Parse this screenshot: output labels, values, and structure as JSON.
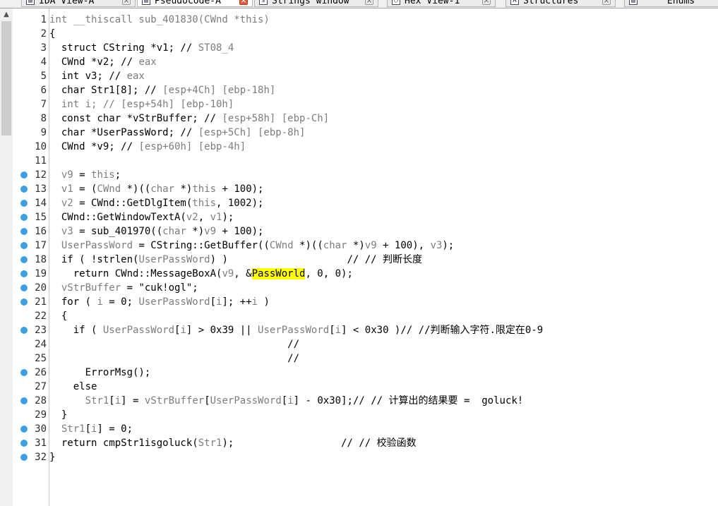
{
  "tabs": [
    {
      "label": "IDA View-A",
      "icon": "ida-view-icon"
    },
    {
      "label": "Pseudocode-A",
      "icon": "pseudocode-icon",
      "active": true
    },
    {
      "label": "Strings window",
      "icon": "strings-icon"
    },
    {
      "label": "Hex View-1",
      "icon": "hex-view-icon"
    },
    {
      "label": "Structures",
      "icon": "structures-icon"
    },
    {
      "label": "Enums",
      "icon": "enums-icon"
    }
  ],
  "code": {
    "lines": [
      {
        "n": "1",
        "dot": false,
        "segs": [
          [
            "c-gray",
            "int __thiscall sub_401830(CWnd *this)"
          ]
        ]
      },
      {
        "n": "2",
        "dot": false,
        "segs": [
          [
            "",
            "{"
          ]
        ]
      },
      {
        "n": "3",
        "dot": false,
        "segs": [
          [
            "",
            "  struct CString *v1; // "
          ],
          [
            "c-gray",
            "ST08_4"
          ]
        ]
      },
      {
        "n": "4",
        "dot": false,
        "segs": [
          [
            "",
            "  CWnd *v2; // "
          ],
          [
            "c-gray",
            "eax"
          ]
        ]
      },
      {
        "n": "5",
        "dot": false,
        "segs": [
          [
            "",
            "  int v3; // "
          ],
          [
            "c-gray",
            "eax"
          ]
        ]
      },
      {
        "n": "6",
        "dot": false,
        "segs": [
          [
            "",
            "  char Str1[8]; // "
          ],
          [
            "c-gray",
            "[esp+4Ch] [ebp-18h]"
          ]
        ]
      },
      {
        "n": "7",
        "dot": false,
        "segs": [
          [
            "c-gray",
            "  int i; // [esp+54h] [ebp-10h]"
          ]
        ]
      },
      {
        "n": "8",
        "dot": false,
        "segs": [
          [
            "",
            "  const char *vStrBuffer; // "
          ],
          [
            "c-gray",
            "[esp+58h] [ebp-Ch]"
          ]
        ]
      },
      {
        "n": "9",
        "dot": false,
        "segs": [
          [
            "",
            "  char *UserPassWord; // "
          ],
          [
            "c-gray",
            "[esp+5Ch] [ebp-8h]"
          ]
        ]
      },
      {
        "n": "10",
        "dot": false,
        "segs": [
          [
            "",
            "  CWnd *v9; // "
          ],
          [
            "c-gray",
            "[esp+60h] [ebp-4h]"
          ]
        ]
      },
      {
        "n": "11",
        "dot": false,
        "segs": [
          [
            "",
            ""
          ]
        ]
      },
      {
        "n": "12",
        "dot": true,
        "segs": [
          [
            "c-gray",
            "  v9"
          ],
          [
            "",
            " = "
          ],
          [
            "c-gray",
            "this"
          ],
          [
            "",
            ";"
          ]
        ]
      },
      {
        "n": "13",
        "dot": true,
        "segs": [
          [
            "c-gray",
            "  v1"
          ],
          [
            "",
            " = ("
          ],
          [
            "c-gray",
            "CWnd"
          ],
          [
            "",
            " *)(("
          ],
          [
            "c-gray",
            "char"
          ],
          [
            "",
            " *)"
          ],
          [
            "c-gray",
            "this"
          ],
          [
            "",
            " + 100);"
          ]
        ]
      },
      {
        "n": "14",
        "dot": true,
        "segs": [
          [
            "c-gray",
            "  v2"
          ],
          [
            "",
            " = CWnd::GetDlgItem("
          ],
          [
            "c-gray",
            "this"
          ],
          [
            "",
            ", 1002);"
          ]
        ]
      },
      {
        "n": "15",
        "dot": true,
        "segs": [
          [
            "",
            "  CWnd::GetWindowTextA("
          ],
          [
            "c-gray",
            "v2"
          ],
          [
            "",
            ", "
          ],
          [
            "c-gray",
            "v1"
          ],
          [
            "",
            ");"
          ]
        ]
      },
      {
        "n": "16",
        "dot": true,
        "segs": [
          [
            "c-gray",
            "  v3"
          ],
          [
            "",
            " = sub_401970(("
          ],
          [
            "c-gray",
            "char"
          ],
          [
            "",
            " *)"
          ],
          [
            "c-gray",
            "v9"
          ],
          [
            "",
            " + 100);"
          ]
        ]
      },
      {
        "n": "17",
        "dot": true,
        "segs": [
          [
            "c-gray",
            "  UserPassWord"
          ],
          [
            "",
            " = CString::GetBuffer(("
          ],
          [
            "c-gray",
            "CWnd"
          ],
          [
            "",
            " *)(("
          ],
          [
            "c-gray",
            "char"
          ],
          [
            "",
            " *)"
          ],
          [
            "c-gray",
            "v9"
          ],
          [
            "",
            " + 100), "
          ],
          [
            "c-gray",
            "v3"
          ],
          [
            "",
            ");"
          ]
        ]
      },
      {
        "n": "18",
        "dot": true,
        "segs": [
          [
            "",
            "  if ( !strlen("
          ],
          [
            "c-gray",
            "UserPassWord"
          ],
          [
            "",
            ") )                    // // 判断长度"
          ]
        ]
      },
      {
        "n": "19",
        "dot": true,
        "segs": [
          [
            "",
            "    return CWnd::MessageBoxA("
          ],
          [
            "c-gray",
            "v9"
          ],
          [
            "",
            ", &"
          ],
          [
            "hl",
            "PassWorld"
          ],
          [
            "",
            ", 0, 0);"
          ]
        ]
      },
      {
        "n": "20",
        "dot": true,
        "segs": [
          [
            "c-gray",
            "  vStrBuffer"
          ],
          [
            "",
            " = \"cuk!ogl\";"
          ]
        ]
      },
      {
        "n": "21",
        "dot": true,
        "segs": [
          [
            "",
            "  for ( "
          ],
          [
            "c-gray",
            "i"
          ],
          [
            "",
            " = 0; "
          ],
          [
            "c-gray",
            "UserPassWord"
          ],
          [
            "",
            "["
          ],
          [
            "c-gray",
            "i"
          ],
          [
            "",
            "]; ++"
          ],
          [
            "c-gray",
            "i"
          ],
          [
            "",
            " )"
          ]
        ]
      },
      {
        "n": "22",
        "dot": false,
        "segs": [
          [
            "",
            "  {"
          ]
        ]
      },
      {
        "n": "23",
        "dot": true,
        "segs": [
          [
            "",
            "    if ( "
          ],
          [
            "c-gray",
            "UserPassWord"
          ],
          [
            "",
            "["
          ],
          [
            "c-gray",
            "i"
          ],
          [
            "",
            "] > 0x39 || "
          ],
          [
            "c-gray",
            "UserPassWord"
          ],
          [
            "",
            "["
          ],
          [
            "c-gray",
            "i"
          ],
          [
            "",
            "] < 0x30 )// //判断输入字符.限定在0-9"
          ]
        ]
      },
      {
        "n": "24",
        "dot": false,
        "segs": [
          [
            "",
            "                                        //"
          ]
        ]
      },
      {
        "n": "25",
        "dot": false,
        "segs": [
          [
            "",
            "                                        //"
          ]
        ]
      },
      {
        "n": "26",
        "dot": true,
        "segs": [
          [
            "",
            "      ErrorMsg();"
          ]
        ]
      },
      {
        "n": "27",
        "dot": false,
        "segs": [
          [
            "",
            "    else"
          ]
        ]
      },
      {
        "n": "28",
        "dot": true,
        "segs": [
          [
            "",
            "      "
          ],
          [
            "c-gray",
            "Str1"
          ],
          [
            "",
            "["
          ],
          [
            "c-gray",
            "i"
          ],
          [
            "",
            "] = "
          ],
          [
            "c-gray",
            "vStrBuffer"
          ],
          [
            "",
            "["
          ],
          [
            "c-gray",
            "UserPassWord"
          ],
          [
            "",
            "["
          ],
          [
            "c-gray",
            "i"
          ],
          [
            "",
            "] - 0x30];// // 计算出的结果要 =  goluck!"
          ]
        ]
      },
      {
        "n": "29",
        "dot": false,
        "segs": [
          [
            "",
            "  }"
          ]
        ]
      },
      {
        "n": "30",
        "dot": true,
        "segs": [
          [
            "c-gray",
            "  Str1"
          ],
          [
            "",
            "["
          ],
          [
            "c-gray",
            "i"
          ],
          [
            "",
            "] = 0;"
          ]
        ]
      },
      {
        "n": "31",
        "dot": true,
        "segs": [
          [
            "",
            "  return cmpStr1isgoluck("
          ],
          [
            "c-gray",
            "Str1"
          ],
          [
            "",
            ");                  // // 校验函数"
          ]
        ]
      },
      {
        "n": "32",
        "dot": true,
        "segs": [
          [
            "",
            "}"
          ]
        ]
      }
    ]
  },
  "colors": {
    "keyword": "#000000",
    "variable": "#7d7d7d",
    "highlight": "#ffff00",
    "breakpoint_dot": "#3ba1e3"
  }
}
